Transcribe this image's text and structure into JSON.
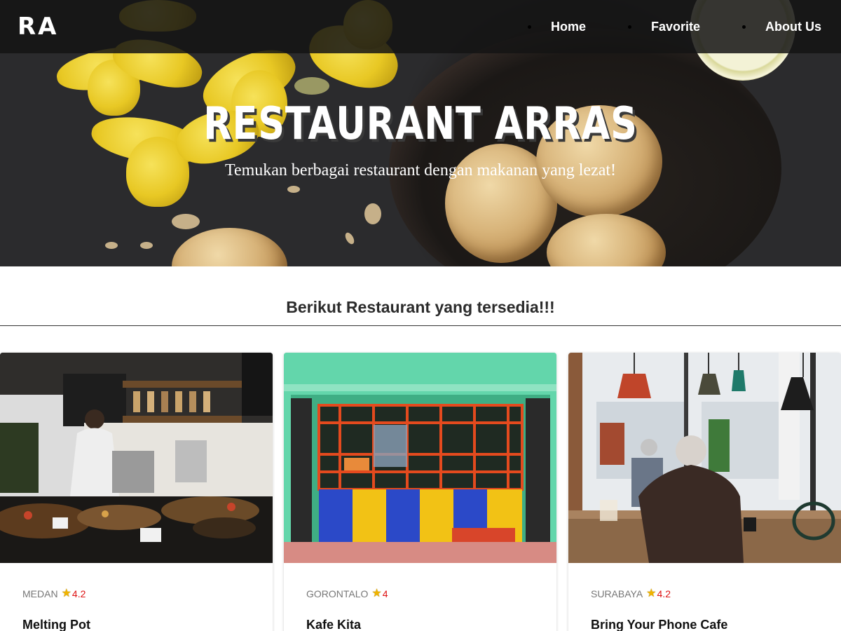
{
  "nav": {
    "brand": "RA",
    "items": [
      {
        "label": "Home"
      },
      {
        "label": "Favorite"
      },
      {
        "label": "About Us"
      }
    ]
  },
  "hero": {
    "title": "RESTAURANT ARRAS",
    "subtitle": "Temukan berbagai restaurant dengan makanan yang lezat!"
  },
  "section": {
    "heading": "Berikut Restaurant yang tersedia!!!"
  },
  "restaurants": [
    {
      "city": "MEDAN",
      "rating": "4.2",
      "name": "Melting Pot"
    },
    {
      "city": "GORONTALO",
      "rating": "4",
      "name": "Kafe Kita"
    },
    {
      "city": "SURABAYA",
      "rating": "4.2",
      "name": "Bring Your Phone Cafe"
    }
  ],
  "icons": {
    "rating": "star-icon"
  },
  "colors": {
    "rating_text": "#dd1111",
    "star": "#f0b400",
    "navbar": "#141414"
  }
}
